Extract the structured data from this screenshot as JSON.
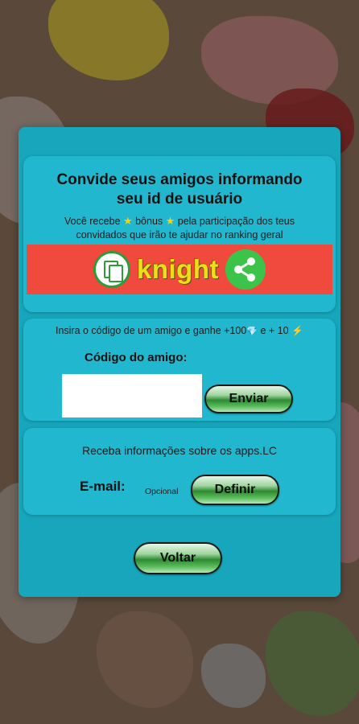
{
  "dialog": {
    "invite": {
      "title_line1": "Convide seus amigos informando",
      "title_line2": "seu id de usuário",
      "subtitle_part1": "Você recebe ",
      "subtitle_part2": " bônus ",
      "subtitle_part3": " pela participação dos teus",
      "subtitle_line2": "convidados que irão te ajudar no ranking geral",
      "star_glyph": "★",
      "user_id": "knight",
      "copy_icon": "copy-icon",
      "share_icon": "share-icon"
    },
    "friend_code": {
      "note_part1": "Insira o código de um amigo e ganhe +100",
      "gem_glyph": "💎",
      "note_part2": " e + 10",
      "bolt_glyph": "⚡",
      "label": "Código do amigo:",
      "input_value": "",
      "send_label": "Enviar"
    },
    "newsletter": {
      "info_text": "Receba informações sobre os apps.LC",
      "email_label": "E-mail:",
      "optional_label": "Opcional",
      "define_label": "Definir"
    },
    "back_label": "Voltar"
  },
  "colors": {
    "dialog_bg": "#18a6bd",
    "card_bg": "#21b8cf",
    "banner_bg": "#f0493e",
    "user_id_color": "#eedd18",
    "button_green": "#2d8a30",
    "share_green": "#3cc44a"
  }
}
